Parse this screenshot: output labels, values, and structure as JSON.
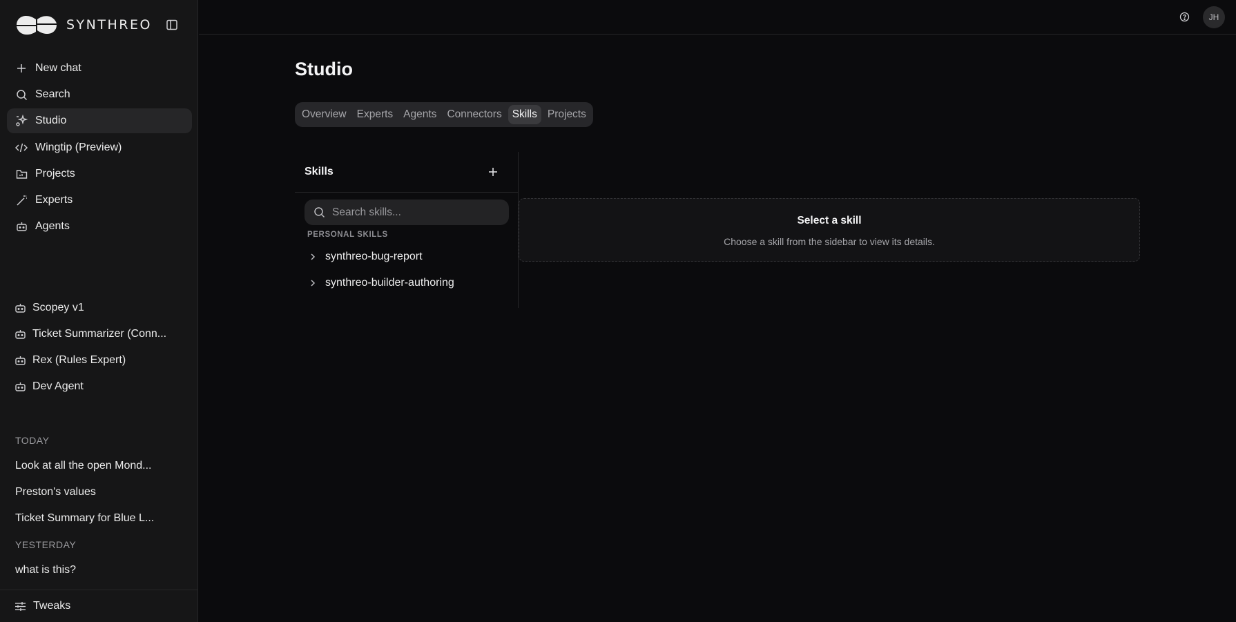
{
  "brand": {
    "name": "SYNTHREO",
    "logo_icon": "synthreo-logo"
  },
  "sidebar": {
    "collapse_icon": "sidebar-toggle-icon",
    "nav": [
      {
        "label": "New chat",
        "icon": "plus-icon"
      },
      {
        "label": "Search",
        "icon": "search-icon"
      },
      {
        "label": "Studio",
        "icon": "studio-sparkle-icon",
        "active": true
      },
      {
        "label": "Wingtip (Preview)",
        "icon": "code-icon"
      },
      {
        "label": "Projects",
        "icon": "folder-icon"
      },
      {
        "label": "Experts",
        "icon": "wand-icon"
      },
      {
        "label": "Agents",
        "icon": "bot-icon"
      }
    ],
    "agents": [
      {
        "label": "Scopey v1",
        "icon": "bot-icon"
      },
      {
        "label": "Ticket Summarizer (Conn...",
        "icon": "bot-icon"
      },
      {
        "label": "Rex (Rules Expert)",
        "icon": "bot-icon"
      },
      {
        "label": "Dev Agent",
        "icon": "bot-icon"
      }
    ],
    "today_label": "TODAY",
    "today_chats": [
      "Look at all the open Mond...",
      "Preston's values",
      "Ticket Summary for Blue L..."
    ],
    "yesterday_label": "YESTERDAY",
    "yesterday_chats": [
      "what is this?"
    ],
    "bottom": {
      "label": "Tweaks",
      "icon": "sliders-icon"
    }
  },
  "topbar": {
    "help_icon": "help-circle-icon",
    "avatar_initials": "JH"
  },
  "main": {
    "title": "Studio",
    "tabs": [
      {
        "label": "Overview"
      },
      {
        "label": "Experts"
      },
      {
        "label": "Agents"
      },
      {
        "label": "Connectors"
      },
      {
        "label": "Skills",
        "active": true
      },
      {
        "label": "Projects"
      }
    ],
    "skills": {
      "title": "Skills",
      "add_icon": "plus-icon",
      "search_placeholder": "Search skills...",
      "section_label": "PERSONAL SKILLS",
      "items": [
        {
          "label": "synthreo-bug-report"
        },
        {
          "label": "synthreo-builder-authoring"
        }
      ]
    },
    "detail": {
      "title": "Select a skill",
      "subtitle": "Choose a skill from the sidebar to view its details."
    }
  },
  "colors": {
    "background": "#0b0b0d",
    "sidebar": "#161617",
    "active_item": "#262628",
    "text": "#ececec",
    "muted": "#9a9a9e"
  }
}
